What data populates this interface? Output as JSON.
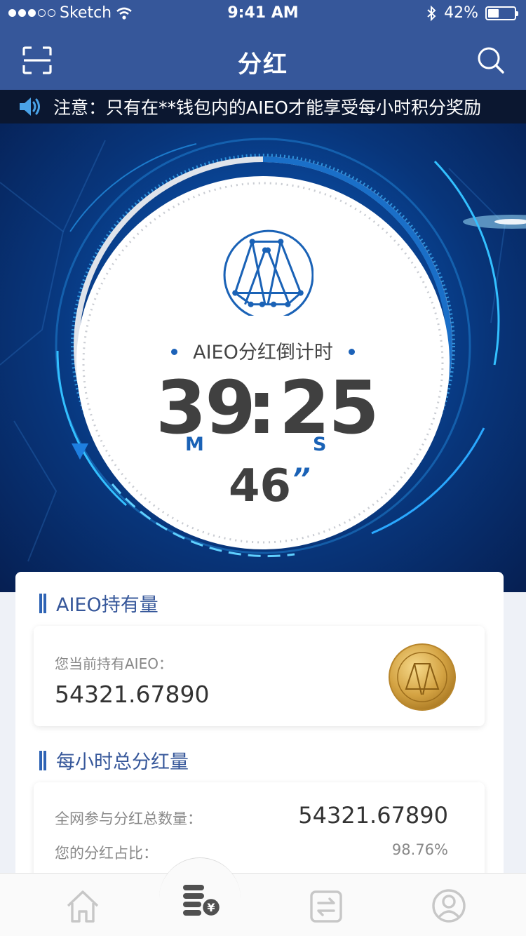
{
  "status_bar": {
    "carrier": "Sketch",
    "time": "9:41 AM",
    "battery": "42%",
    "battery_level": 0.42
  },
  "header": {
    "title": "分红",
    "left_icon": "scan-icon",
    "right_icon": "search-icon"
  },
  "notice": {
    "icon": "speaker-icon",
    "text": "注意：只有在**钱包内的AIEO才能享受每小时积分奖励"
  },
  "countdown": {
    "label": "AIEO分红倒计时",
    "minutes": "39",
    "separator": ":",
    "seconds": "25",
    "minutes_unit": "M",
    "seconds_unit": "S",
    "subseconds": "46",
    "subseconds_mark": "’’"
  },
  "holdings": {
    "section_title": "AIEO持有量",
    "label": "您当前持有AIEO：",
    "value": "54321.67890"
  },
  "dividend": {
    "section_title": "每小时总分红量",
    "total_label": "全网参与分红总数量：",
    "total_value": "54321.67890",
    "share_label": "您的分红占比：",
    "share_value": "98.76%"
  },
  "tabbar": {
    "items": [
      {
        "icon": "home-icon",
        "active": false
      },
      {
        "icon": "dividend-coins-icon",
        "active": true
      },
      {
        "icon": "exchange-icon",
        "active": false
      },
      {
        "icon": "profile-icon",
        "active": false
      }
    ]
  },
  "colors": {
    "header_bg": "#36579a",
    "accent": "#1a62b6",
    "notice_bg": "#0b1730"
  }
}
